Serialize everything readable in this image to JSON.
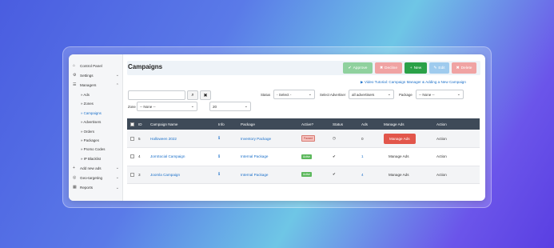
{
  "sidebar": {
    "items": [
      {
        "label": "Control Panel",
        "icon": "home-icon"
      },
      {
        "label": "Settings",
        "icon": "gear-icon"
      },
      {
        "label": "Managers",
        "icon": "list-icon"
      }
    ],
    "sub_items": [
      {
        "label": "» Ads",
        "active": false
      },
      {
        "label": "» Zones",
        "active": false
      },
      {
        "label": "» Campaigns",
        "active": true
      },
      {
        "label": "» Advertisers",
        "active": false
      },
      {
        "label": "» Orders",
        "active": false
      },
      {
        "label": "» Packages",
        "active": false
      },
      {
        "label": "» Promo Codes",
        "active": false
      },
      {
        "label": "» IP Blacklist",
        "active": false
      }
    ],
    "bottom_items": [
      {
        "label": "Add new ads",
        "icon": "plus-icon"
      },
      {
        "label": "Geo-targeting",
        "icon": "globe-icon"
      },
      {
        "label": "Reports",
        "icon": "chart-icon"
      }
    ]
  },
  "header": {
    "title": "Campaigns",
    "buttons": {
      "approve": "Approve",
      "decline": "Decline",
      "new": "New",
      "edit": "Edit",
      "delete": "Delete"
    },
    "colors": {
      "approve": "#8fd19e",
      "decline": "#f0a3a3",
      "new": "#2aa148",
      "edit": "#9fcbee",
      "delete": "#f0a3a3"
    }
  },
  "tutorial_link": "Video Tutorial: Campaign Manager & Adding a New Campaign",
  "filters": {
    "search_value": "",
    "status_label": "Status",
    "status_value": "- Select -",
    "advertiser_label": "Select Advertiser",
    "advertiser_value": "all advertisers",
    "package_label": "Package",
    "package_value": "-- None --",
    "zone_label": "Zone",
    "zone_value": "-- None --",
    "limit_value": "20"
  },
  "table": {
    "headers": [
      "",
      "ID",
      "Campaign Name",
      "Info",
      "Package",
      "Active?",
      "Status",
      "Ads",
      "Manage Ads",
      "Action"
    ],
    "rows": [
      {
        "id": "5",
        "name": "Halloween 2022",
        "package": "Inventory Package",
        "active": "Paused",
        "status": "pending",
        "ads": "0",
        "manage": "Manage Ads",
        "action": "Action"
      },
      {
        "id": "4",
        "name": "JomSocial Campaign",
        "package": "Internal Package",
        "active": "Active",
        "status": "active",
        "ads": "1",
        "manage": "Manage Ads",
        "action": "Action"
      },
      {
        "id": "3",
        "name": "Joomla Campaign",
        "package": "Internal Package",
        "active": "Active",
        "status": "active",
        "ads": "4",
        "manage": "Manage Ads",
        "action": "Action"
      }
    ]
  }
}
